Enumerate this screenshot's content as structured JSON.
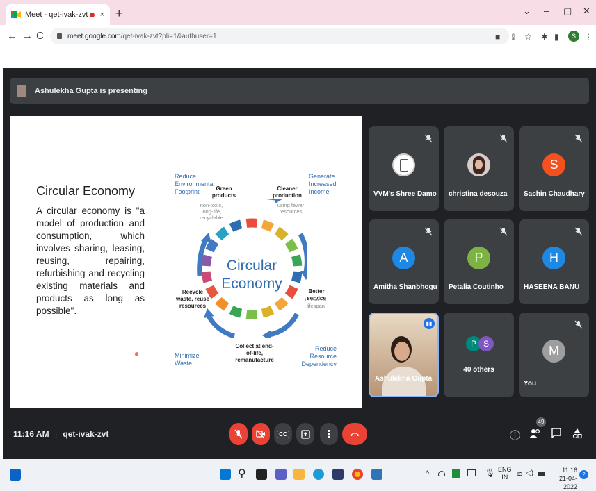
{
  "browser": {
    "tab_title": "Meet - qet-ivak-zvt",
    "tab_close": "×",
    "new_tab": "+",
    "url_host": "meet.google.com",
    "url_path": "/qet-ivak-zvt?pli=1&authuser=1",
    "profile_initial": "S",
    "window_controls": [
      "⌄",
      "–",
      "▢",
      "✕"
    ]
  },
  "presenting_banner": "Ashulekha Gupta is presenting",
  "slide": {
    "title": "Circular Economy",
    "body": "A circular economy is \"a model of production and consumption, which involves sharing, leasing, reusing, repairing, refurbishing and recycling existing materials and products as long as possible\".",
    "center_line1": "Circular",
    "center_line2": "Economy",
    "labels": {
      "reduce_footprint": "Reduce Environmental Footprint",
      "green_products": "Green products",
      "green_sub": "non-toxic, long-life, recyclable",
      "cleaner_production": "Cleaner production",
      "cleaner_sub": "using fewer resources",
      "generate_income": "Generate Increased Income",
      "better_service": "Better service",
      "better_sub": "to extend lifespan",
      "reduce_dependency": "Reduce Resource Dependency",
      "collect": "Collect at end-of-life, remanufacture",
      "minimize_waste": "Minimize Waste",
      "recycle": "Recycle waste, reuse resources"
    },
    "ring_colors": [
      "#2f6db3",
      "#e94e3d",
      "#f4a63b",
      "#d9b22a",
      "#7bbf4a",
      "#3aa655",
      "#f28e2b",
      "#e9553d",
      "#c94a77",
      "#8a5aa8",
      "#3f7ac2",
      "#27a3c4"
    ]
  },
  "participants": [
    {
      "name": "VVM's Shree Damo...",
      "initial": "",
      "color": "#ffffff"
    },
    {
      "name": "christina desouza",
      "initial": "",
      "color": "#d7ccc8"
    },
    {
      "name": "Sachin Chaudhary",
      "initial": "S",
      "color": "#f4511e"
    },
    {
      "name": "Amitha Shanbhogue",
      "initial": "A",
      "color": "#1e88e5"
    },
    {
      "name": "Petalia Coutinho",
      "initial": "P",
      "color": "#7cb342"
    },
    {
      "name": "HASEENA BANU",
      "initial": "H",
      "color": "#1e88e5"
    },
    {
      "name": "Ashulekha Gupta",
      "initial": "",
      "color": "#c9a98c"
    },
    {
      "name": "40 others",
      "initial": "",
      "color": ""
    },
    {
      "name": "You",
      "initial": "M",
      "color": "#9e9e9e"
    }
  ],
  "others_initials": [
    "P",
    "S"
  ],
  "controls": {
    "time": "11:16 AM",
    "separator": "|",
    "meeting_code": "qet-ivak-zvt",
    "participant_count": "49",
    "cc_label": "CC"
  },
  "taskbar": {
    "lang_line1": "ENG",
    "lang_line2": "IN",
    "time": "11:16",
    "date": "21-04-2022",
    "notification_count": "2"
  }
}
